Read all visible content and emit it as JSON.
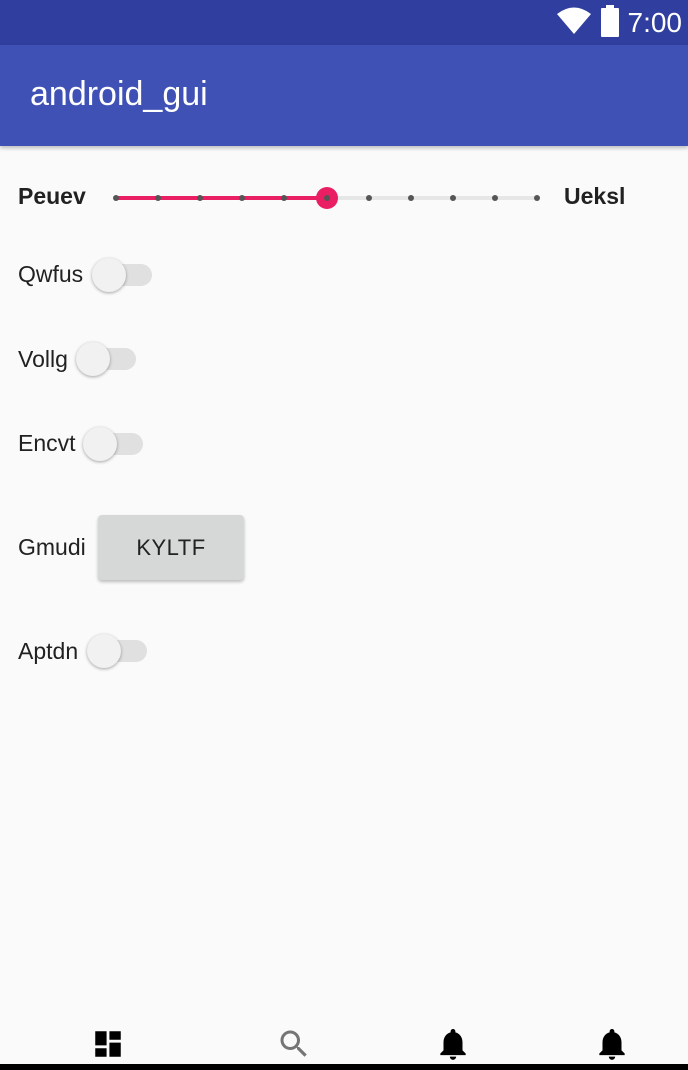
{
  "status_bar": {
    "time": "7:00",
    "icons": [
      "wifi-icon",
      "battery-icon"
    ]
  },
  "app_bar": {
    "title": "android_gui"
  },
  "slider": {
    "min_label": "Peuev",
    "max_label": "Ueksl",
    "steps": 10,
    "value": 5
  },
  "switches": [
    {
      "label": "Qwfus",
      "checked": false
    },
    {
      "label": "Vollg",
      "checked": false
    },
    {
      "label": "Encvt",
      "checked": false
    },
    {
      "label": "Aptdn",
      "checked": false
    }
  ],
  "button_row": {
    "label": "Gmudi",
    "button_label": "KYLTF"
  },
  "bottom_nav": {
    "items": [
      "dashboard-icon",
      "search-icon",
      "notifications-icon",
      "notifications-icon"
    ]
  },
  "colors": {
    "status_bar": "#303f9f",
    "app_bar": "#3f51b5",
    "accent": "#e91e63",
    "background": "#fafafa"
  }
}
